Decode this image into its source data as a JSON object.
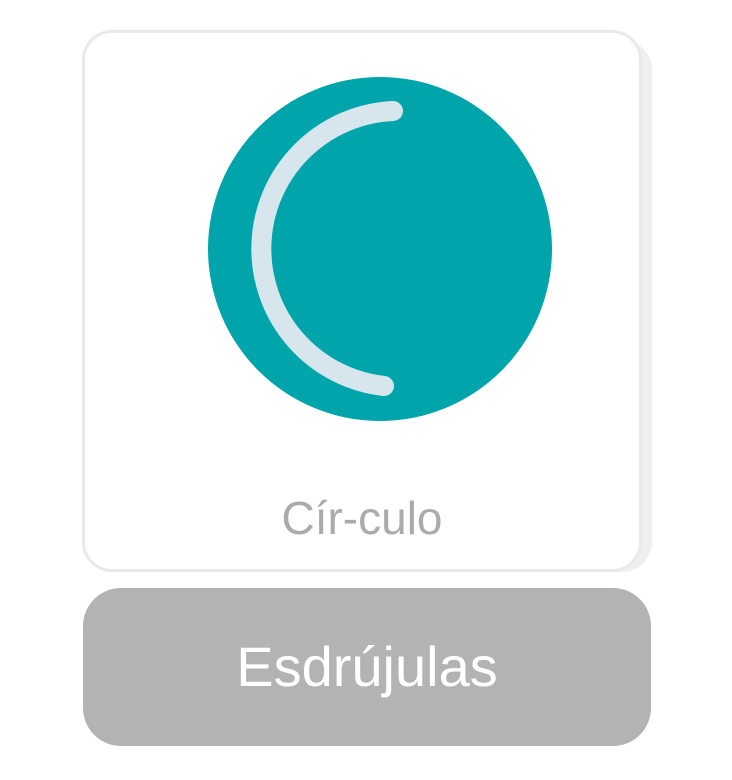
{
  "card": {
    "image_icon": "circle-icon",
    "word": "Cír-culo"
  },
  "category": {
    "label": "Esdrújulas"
  },
  "colors": {
    "circle_fill": "#00a5ab",
    "arc_stroke": "#d7e6ec",
    "word_text": "#ababab",
    "button_bg": "#b3b3b3",
    "button_text": "#ffffff",
    "card_border": "#e9e9e9"
  }
}
